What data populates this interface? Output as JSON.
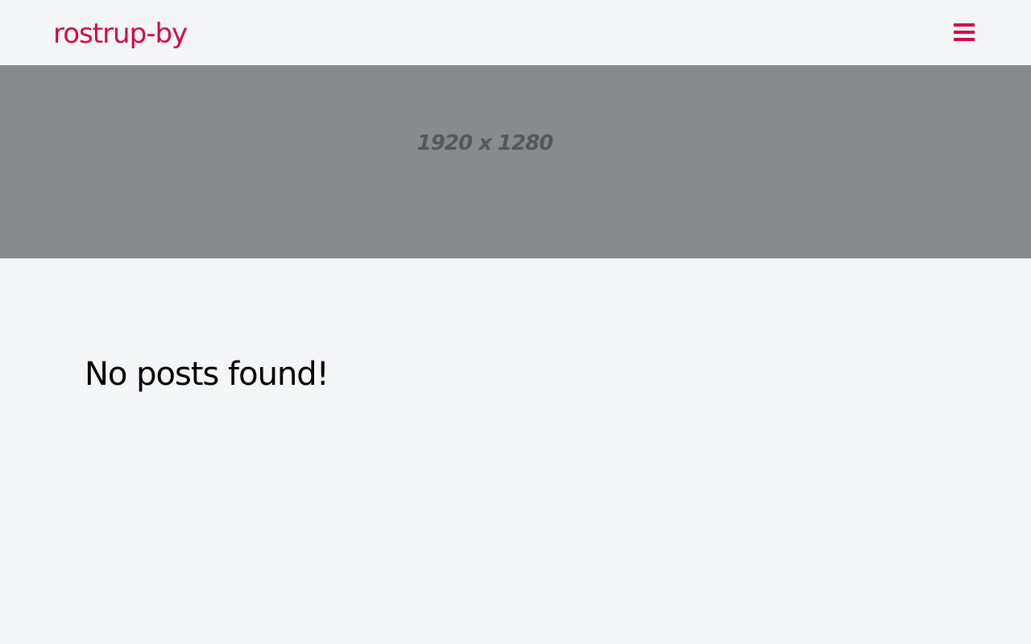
{
  "header": {
    "logo_text": "rostrup-by",
    "menu_icon": "hamburger-menu-icon"
  },
  "hero": {
    "placeholder_text": "1920 x 1280"
  },
  "main": {
    "empty_message": "No posts found!"
  },
  "colors": {
    "brand": "#d6084a",
    "page_background": "#f4f5f7",
    "hero_background": "#888b8b",
    "hero_text": "#555758",
    "body_text": "#000000"
  }
}
